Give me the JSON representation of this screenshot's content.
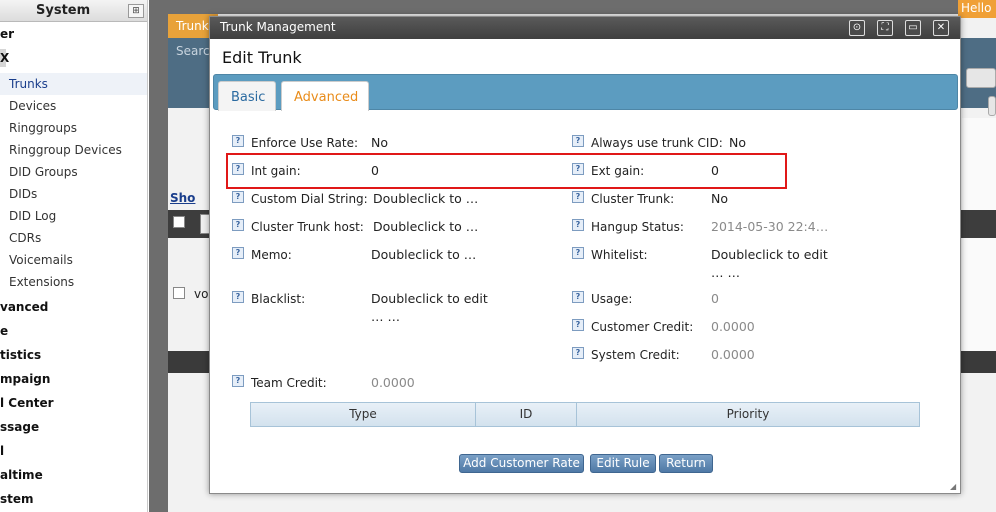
{
  "sidebar": {
    "title": "System",
    "pin_glyph": "⊞",
    "items": [
      {
        "label": "er"
      },
      {
        "label": "X"
      },
      {
        "label": "Trunks"
      },
      {
        "label": "Devices"
      },
      {
        "label": "Ringgroups"
      },
      {
        "label": "Ringgroup Devices"
      },
      {
        "label": "DID Groups"
      },
      {
        "label": "DIDs"
      },
      {
        "label": "DID Log"
      },
      {
        "label": "CDRs"
      },
      {
        "label": "Voicemails"
      },
      {
        "label": "Extensions"
      },
      {
        "label": "vanced"
      },
      {
        "label": "e"
      },
      {
        "label": "tistics"
      },
      {
        "label": "mpaign"
      },
      {
        "label": "l Center"
      },
      {
        "label": "ssage"
      },
      {
        "label": "l"
      },
      {
        "label": "altime"
      },
      {
        "label": "stem"
      }
    ]
  },
  "background": {
    "tab_label": "Trunk",
    "search_label": "Searc",
    "show_link": "Sho",
    "row_text": "voi",
    "hello": "Hello a"
  },
  "dialog": {
    "window_title": "Trunk Management",
    "heading": "Edit Trunk",
    "window_buttons": [
      "⊙",
      "⛶",
      "▭",
      "✕"
    ],
    "tabs": [
      {
        "label": "Basic",
        "active": false
      },
      {
        "label": "Advanced",
        "active": true
      }
    ],
    "help_glyph": "?",
    "fields": {
      "enforce_use_rate": {
        "label": "Enforce Use Rate:",
        "value": "No"
      },
      "always_use_trunk_cid": {
        "label": "Always use trunk CID:",
        "value": "No"
      },
      "int_gain": {
        "label": "Int gain:",
        "value": "0"
      },
      "ext_gain": {
        "label": "Ext gain:",
        "value": "0"
      },
      "custom_dial_string": {
        "label": "Custom Dial String:",
        "value": "Doubleclick to …"
      },
      "cluster_trunk": {
        "label": "Cluster Trunk:",
        "value": "No"
      },
      "cluster_trunk_host": {
        "label": "Cluster Trunk host:",
        "value": "Doubleclick to …"
      },
      "hangup_status": {
        "label": "Hangup Status:",
        "value": "2014-05-30 22:4…"
      },
      "memo": {
        "label": "Memo:",
        "value": "Doubleclick to …"
      },
      "whitelist": {
        "label": "Whitelist:",
        "value": "Doubleclick to edit",
        "value_more": "… …"
      },
      "blacklist": {
        "label": "Blacklist:",
        "value": "Doubleclick to edit",
        "value_more": "… …"
      },
      "usage": {
        "label": "Usage:",
        "value": "0"
      },
      "customer_credit": {
        "label": "Customer Credit:",
        "value": "0.0000"
      },
      "system_credit": {
        "label": "System Credit:",
        "value": "0.0000"
      },
      "team_credit": {
        "label": "Team Credit:",
        "value": "0.0000"
      }
    },
    "rate_table": {
      "columns": [
        "Type",
        "ID",
        "Priority"
      ]
    },
    "buttons": {
      "add_customer_rate": "Add Customer Rate",
      "edit_rule": "Edit Rule",
      "return": "Return"
    },
    "colors": {
      "highlight": "#e01818",
      "active_tab": "#e98c1a",
      "tab_bar": "#5c9cc0"
    }
  }
}
